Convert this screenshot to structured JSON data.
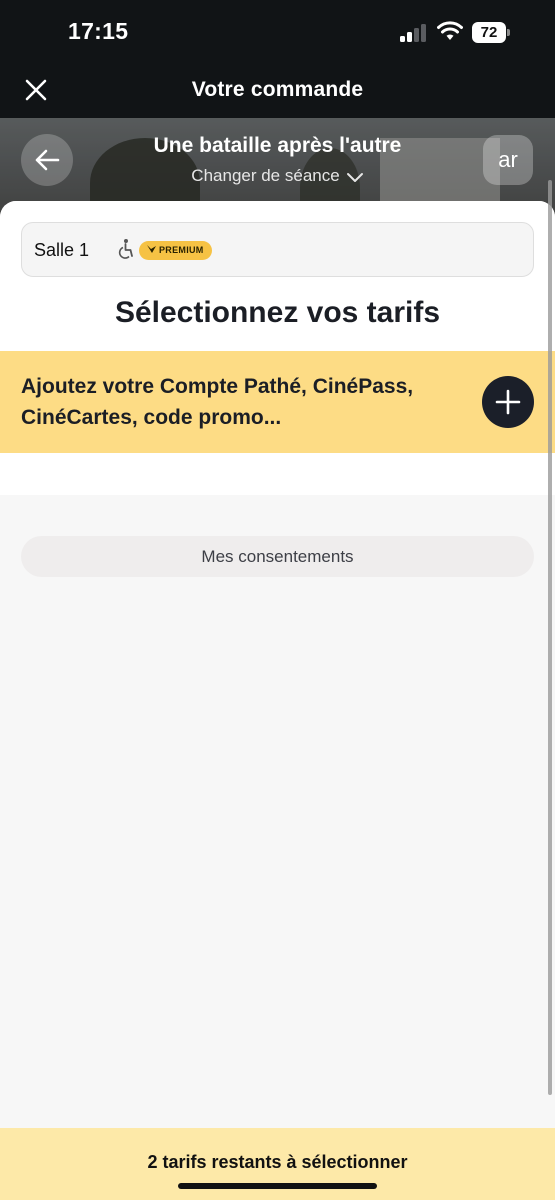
{
  "status_bar": {
    "time": "17:15",
    "battery": "72",
    "icons": [
      "signal-icon",
      "wifi-icon",
      "battery-icon"
    ]
  },
  "header": {
    "title": "Votre commande",
    "close_icon": "close-icon"
  },
  "hero": {
    "movie_title": "Une bataille après l'autre",
    "change_session": "Changer de séance",
    "language_button": "ar",
    "back_icon": "arrow-left-icon",
    "chevron_icon": "chevron-down-icon"
  },
  "room": {
    "name": "Salle 1",
    "accessibility_icon": "wheelchair-icon",
    "badge": "PREMIUM"
  },
  "section_title": "Sélectionnez vos tarifs",
  "promo": {
    "text": "Ajoutez votre Compte Pathé, CinéPass, CinéCartes, code promo...",
    "add_icon": "plus-icon"
  },
  "consent_button": "Mes consentements",
  "footer": {
    "text": "2 tarifs restants à sélectionner"
  },
  "colors": {
    "dark": "#111416",
    "promo_yellow": "#fddc85",
    "footer_yellow": "#fde9a8",
    "badge_gold": "#f6c244",
    "add_button": "#1b1f29"
  }
}
